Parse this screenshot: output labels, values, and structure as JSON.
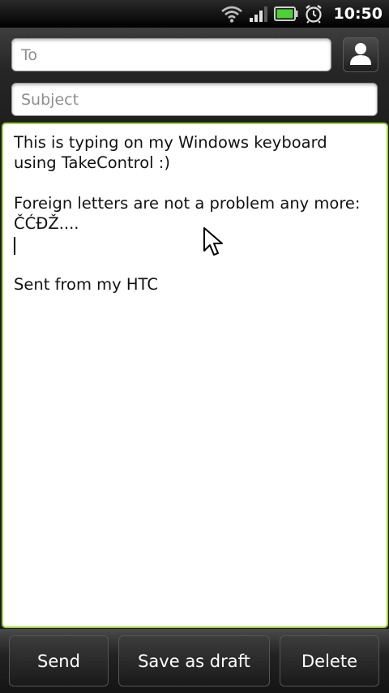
{
  "status_bar": {
    "time": "10:50",
    "icons": [
      "wifi-icon",
      "signal-icon",
      "battery-icon",
      "alarm-icon"
    ],
    "battery_color": "#4cd137"
  },
  "compose": {
    "to_placeholder": "To",
    "subject_placeholder": "Subject",
    "contact_icon": "person-icon",
    "body_lines": [
      "This is typing on my Windows keyboard",
      "using TakeControl :)",
      "",
      "Foreign letters are not a problem any more:",
      "ČĆĐŽ....",
      "",
      "",
      "Sent from my HTC"
    ],
    "accent_color": "#9bd23b"
  },
  "actions": {
    "send_label": "Send",
    "save_draft_label": "Save as draft",
    "delete_label": "Delete"
  }
}
